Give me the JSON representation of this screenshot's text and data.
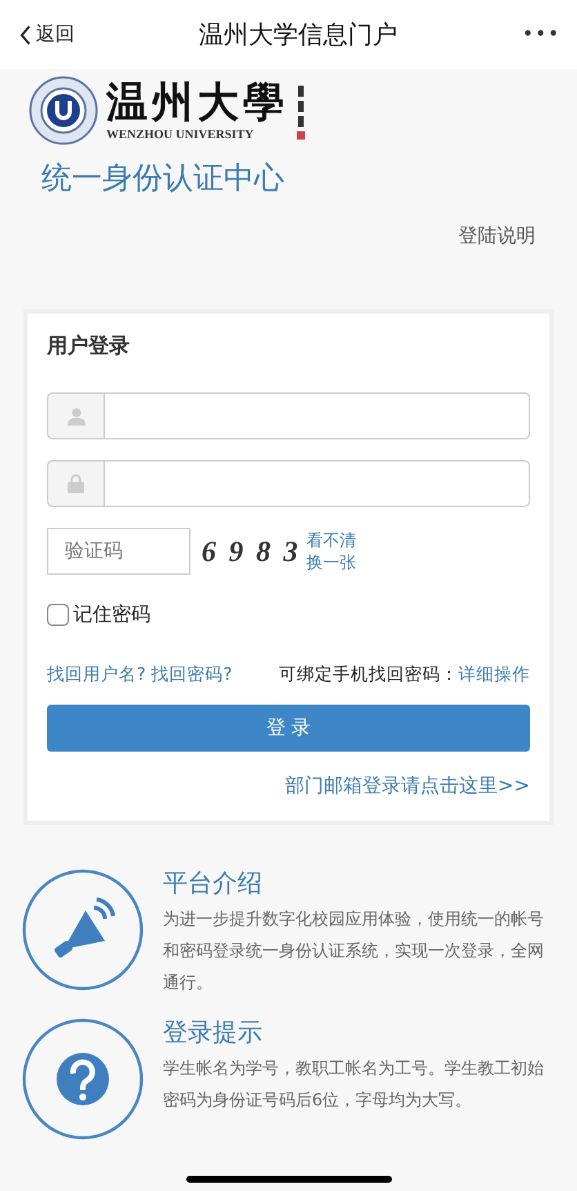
{
  "nav": {
    "back": "返回",
    "title": "温州大学信息门户",
    "more": "•••"
  },
  "logo": {
    "name": "温州大學",
    "english": "WENZHOU UNIVERSITY"
  },
  "heading": "统一身份认证中心",
  "help_link": "登陆说明",
  "login": {
    "title": "用户登录",
    "captcha": {
      "placeholder": "验证码",
      "code": "6 9 8 3",
      "refresh_1": "看不清",
      "refresh_2": "换一张"
    },
    "remember": {
      "label": "记住密码",
      "checked": false
    },
    "links": [
      {
        "label": "找回用户名?"
      },
      {
        "label": "找回密码?"
      }
    ],
    "bind_text": "可绑定手机找回密码：",
    "bind_link": "详细操作",
    "submit": "登 录",
    "dept_link": "部门邮箱登录请点击这里>>"
  },
  "info": [
    {
      "kind": "megaphone",
      "title": "平台介绍",
      "text": "为进一步提升数字化校园应用体验，使用统一的帐号和密码登录统一身份认证系统，实现一次登录，全网通行。"
    },
    {
      "kind": "question",
      "title": "登录提示",
      "text": "学生帐名为学号，教职工帐名为工号。学生教工初始密码为身份证号码后6位，字母均为大写。"
    }
  ]
}
